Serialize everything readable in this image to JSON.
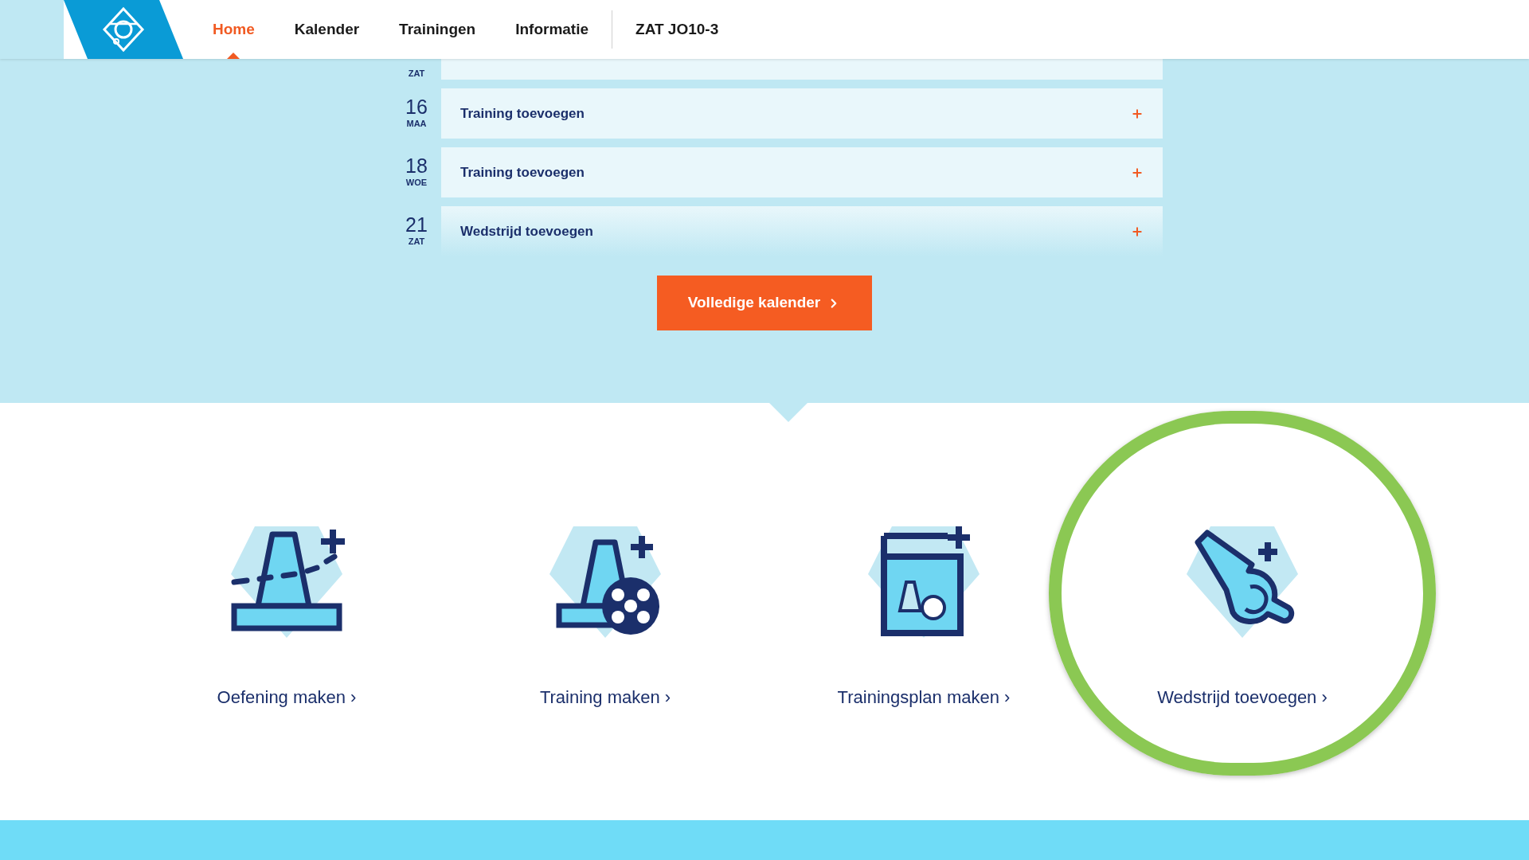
{
  "nav": {
    "items": [
      {
        "label": "Home",
        "selected": true
      },
      {
        "label": "Kalender",
        "selected": false
      },
      {
        "label": "Trainingen",
        "selected": false
      },
      {
        "label": "Informatie",
        "selected": false
      }
    ],
    "team": "ZAT JO10-3"
  },
  "calendar": {
    "rows": [
      {
        "weekday": "ZAT"
      },
      {
        "day": "16",
        "weekday": "MAA",
        "title": "Training toevoegen"
      },
      {
        "day": "18",
        "weekday": "WOE",
        "title": "Training toevoegen"
      },
      {
        "day": "21",
        "weekday": "ZAT",
        "title": "Wedstrijd toevoegen"
      }
    ],
    "button": "Volledige kalender"
  },
  "actions": [
    {
      "kind": "cone",
      "label": "Oefening maken ›",
      "highlighted": false
    },
    {
      "kind": "cone-ball",
      "label": "Training maken ›",
      "highlighted": false
    },
    {
      "kind": "plan",
      "label": "Trainingsplan maken ›",
      "highlighted": false
    },
    {
      "kind": "whistle",
      "label": "Wedstrijd toevoegen ›",
      "highlighted": true
    }
  ]
}
